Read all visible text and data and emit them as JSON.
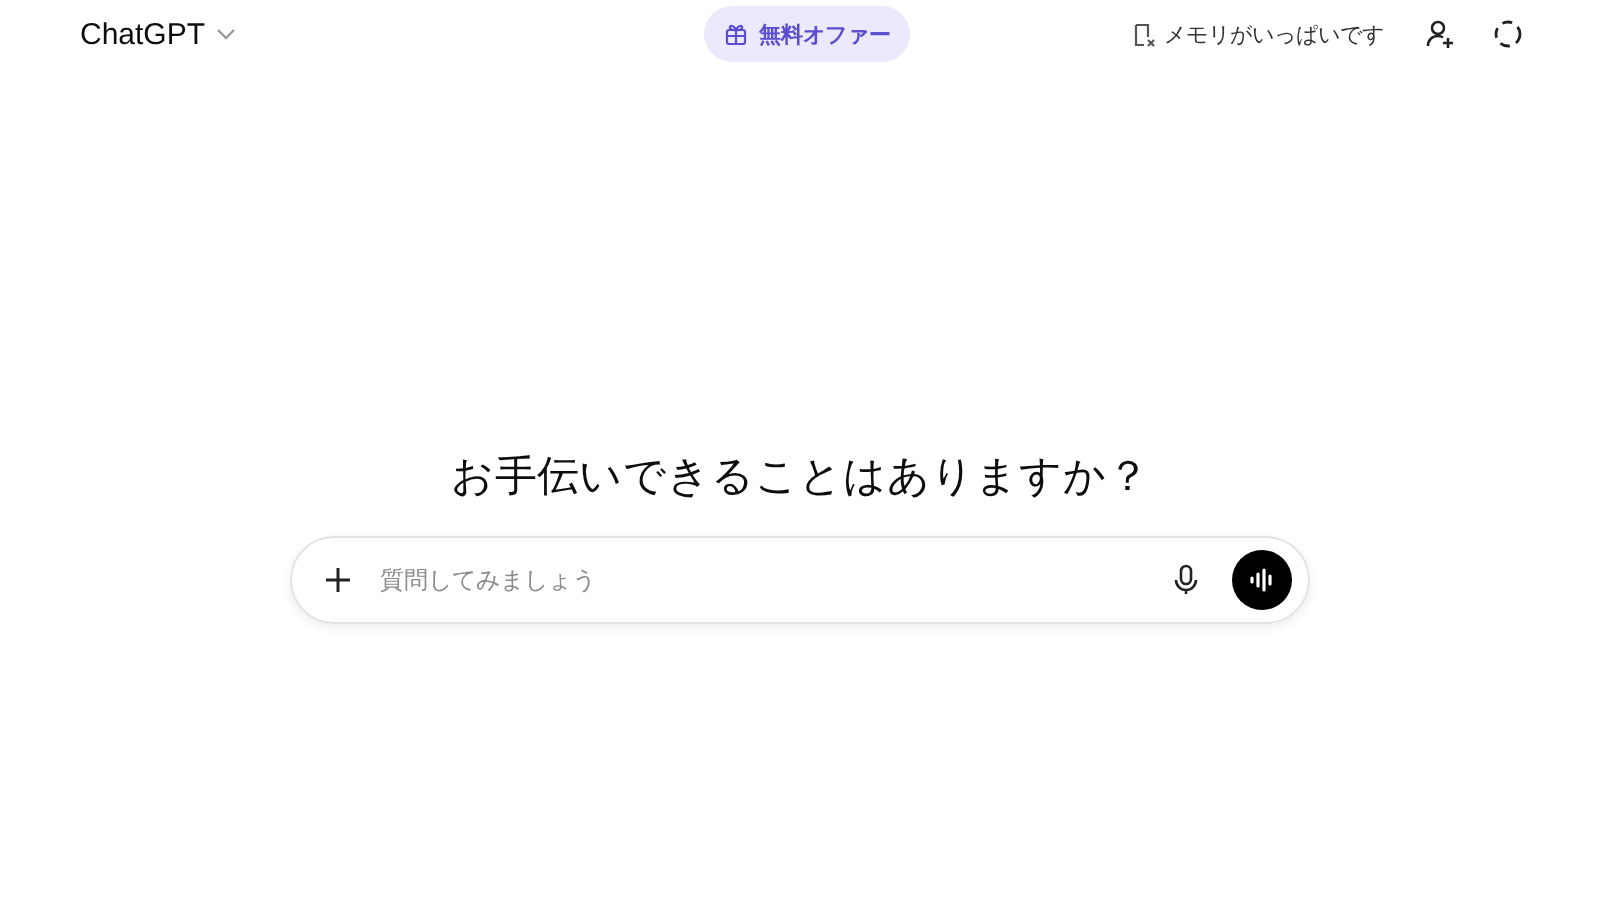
{
  "header": {
    "model": "ChatGPT",
    "offer": "無料オファー",
    "memory": "メモリがいっぱいです"
  },
  "heading": "お手伝いできることはありますか？",
  "composer": {
    "placeholder": "質問してみましょう"
  }
}
